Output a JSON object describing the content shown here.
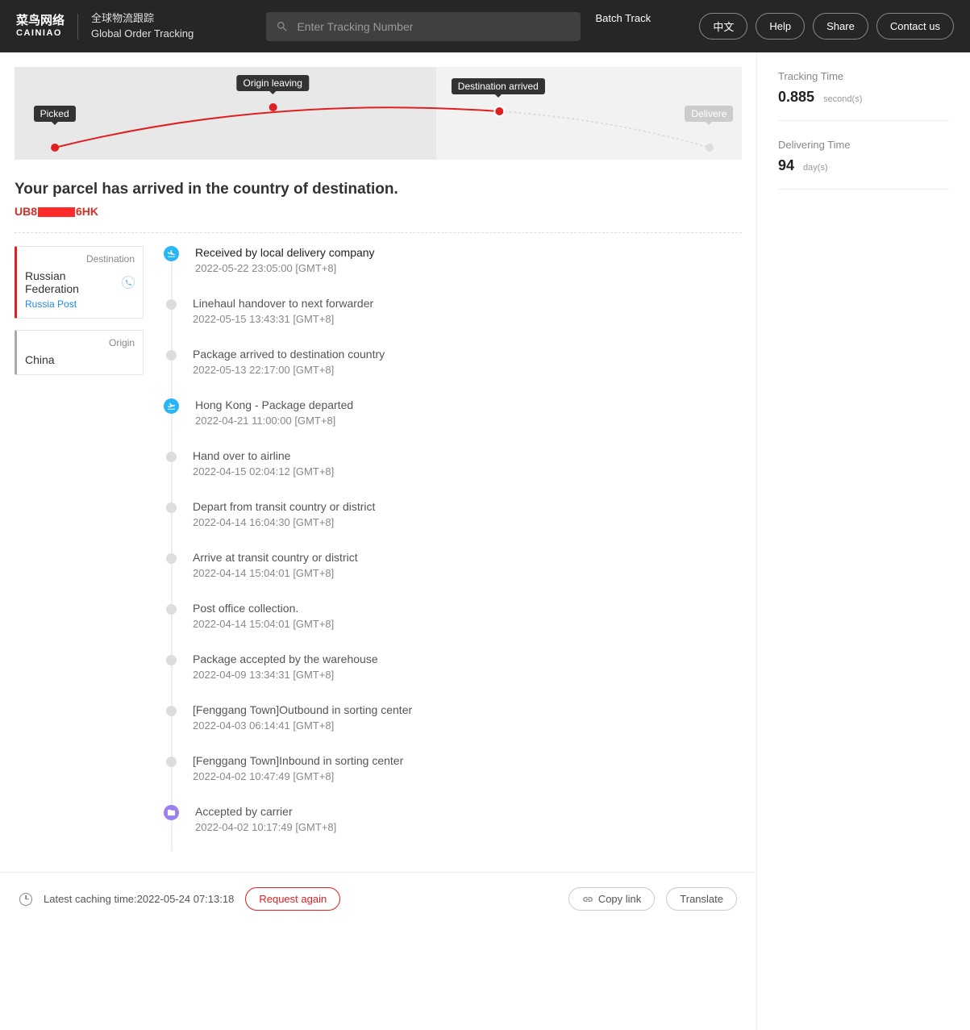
{
  "header": {
    "logo_cn": "菜鸟网络",
    "logo_en": "CAINIAO",
    "subtitle_cn": "全球物流跟踪",
    "subtitle_en": "Global Order Tracking",
    "search_placeholder": "Enter Tracking Number",
    "batch_track": "Batch Track",
    "buttons": {
      "lang": "中文",
      "help": "Help",
      "share": "Share",
      "contact": "Contact us"
    }
  },
  "progress": {
    "stages": [
      {
        "label": "Picked",
        "active": true
      },
      {
        "label": "Origin leaving",
        "active": true
      },
      {
        "label": "Destination arrived",
        "active": true
      },
      {
        "label": "Delivere",
        "active": false
      }
    ]
  },
  "status": {
    "heading": "Your parcel has arrived in the country of destination.",
    "tracking_prefix": "UB8",
    "tracking_suffix": "6HK"
  },
  "destination": {
    "tag": "Destination",
    "country": "Russian Federation",
    "carrier": "Russia Post"
  },
  "origin": {
    "tag": "Origin",
    "country": "China"
  },
  "timeline": [
    {
      "icon": "plane-landing",
      "title": "Received by local delivery company",
      "time": "2022-05-22 23:05:00 [GMT+8]",
      "latest": true
    },
    {
      "icon": "dot",
      "title": "Linehaul handover to next forwarder",
      "time": "2022-05-15 13:43:31 [GMT+8]"
    },
    {
      "icon": "dot",
      "title": "Package arrived to destination country",
      "time": "2022-05-13 22:17:00 [GMT+8]"
    },
    {
      "icon": "plane-takeoff",
      "title": "Hong Kong - Package departed",
      "time": "2022-04-21 11:00:00 [GMT+8]"
    },
    {
      "icon": "dot",
      "title": "Hand over to airline",
      "time": "2022-04-15 02:04:12 [GMT+8]"
    },
    {
      "icon": "dot",
      "title": "Depart from transit country or district",
      "time": "2022-04-14 16:04:30 [GMT+8]"
    },
    {
      "icon": "dot",
      "title": "Arrive at transit country or district",
      "time": "2022-04-14 15:04:01 [GMT+8]"
    },
    {
      "icon": "dot",
      "title": "Post office collection.",
      "time": "2022-04-14 15:04:01 [GMT+8]"
    },
    {
      "icon": "dot",
      "title": "Package accepted by the warehouse",
      "time": "2022-04-09 13:34:31 [GMT+8]"
    },
    {
      "icon": "dot",
      "title": "[Fenggang Town]Outbound in sorting center",
      "time": "2022-04-03 06:14:41 [GMT+8]"
    },
    {
      "icon": "dot",
      "title": "[Fenggang Town]Inbound in sorting center",
      "time": "2022-04-02 10:47:49 [GMT+8]"
    },
    {
      "icon": "box",
      "title": "Accepted by carrier",
      "time": "2022-04-02 10:17:49 [GMT+8]"
    }
  ],
  "side": {
    "tracking_time_label": "Tracking Time",
    "tracking_time_value": "0.885",
    "tracking_time_unit": "second(s)",
    "delivering_time_label": "Delivering Time",
    "delivering_time_value": "94",
    "delivering_time_unit": "day(s)"
  },
  "footer": {
    "cache": "Latest caching time:2022-05-24 07:13:18",
    "request_again": "Request again",
    "copy_link": "Copy link",
    "translate": "Translate"
  }
}
